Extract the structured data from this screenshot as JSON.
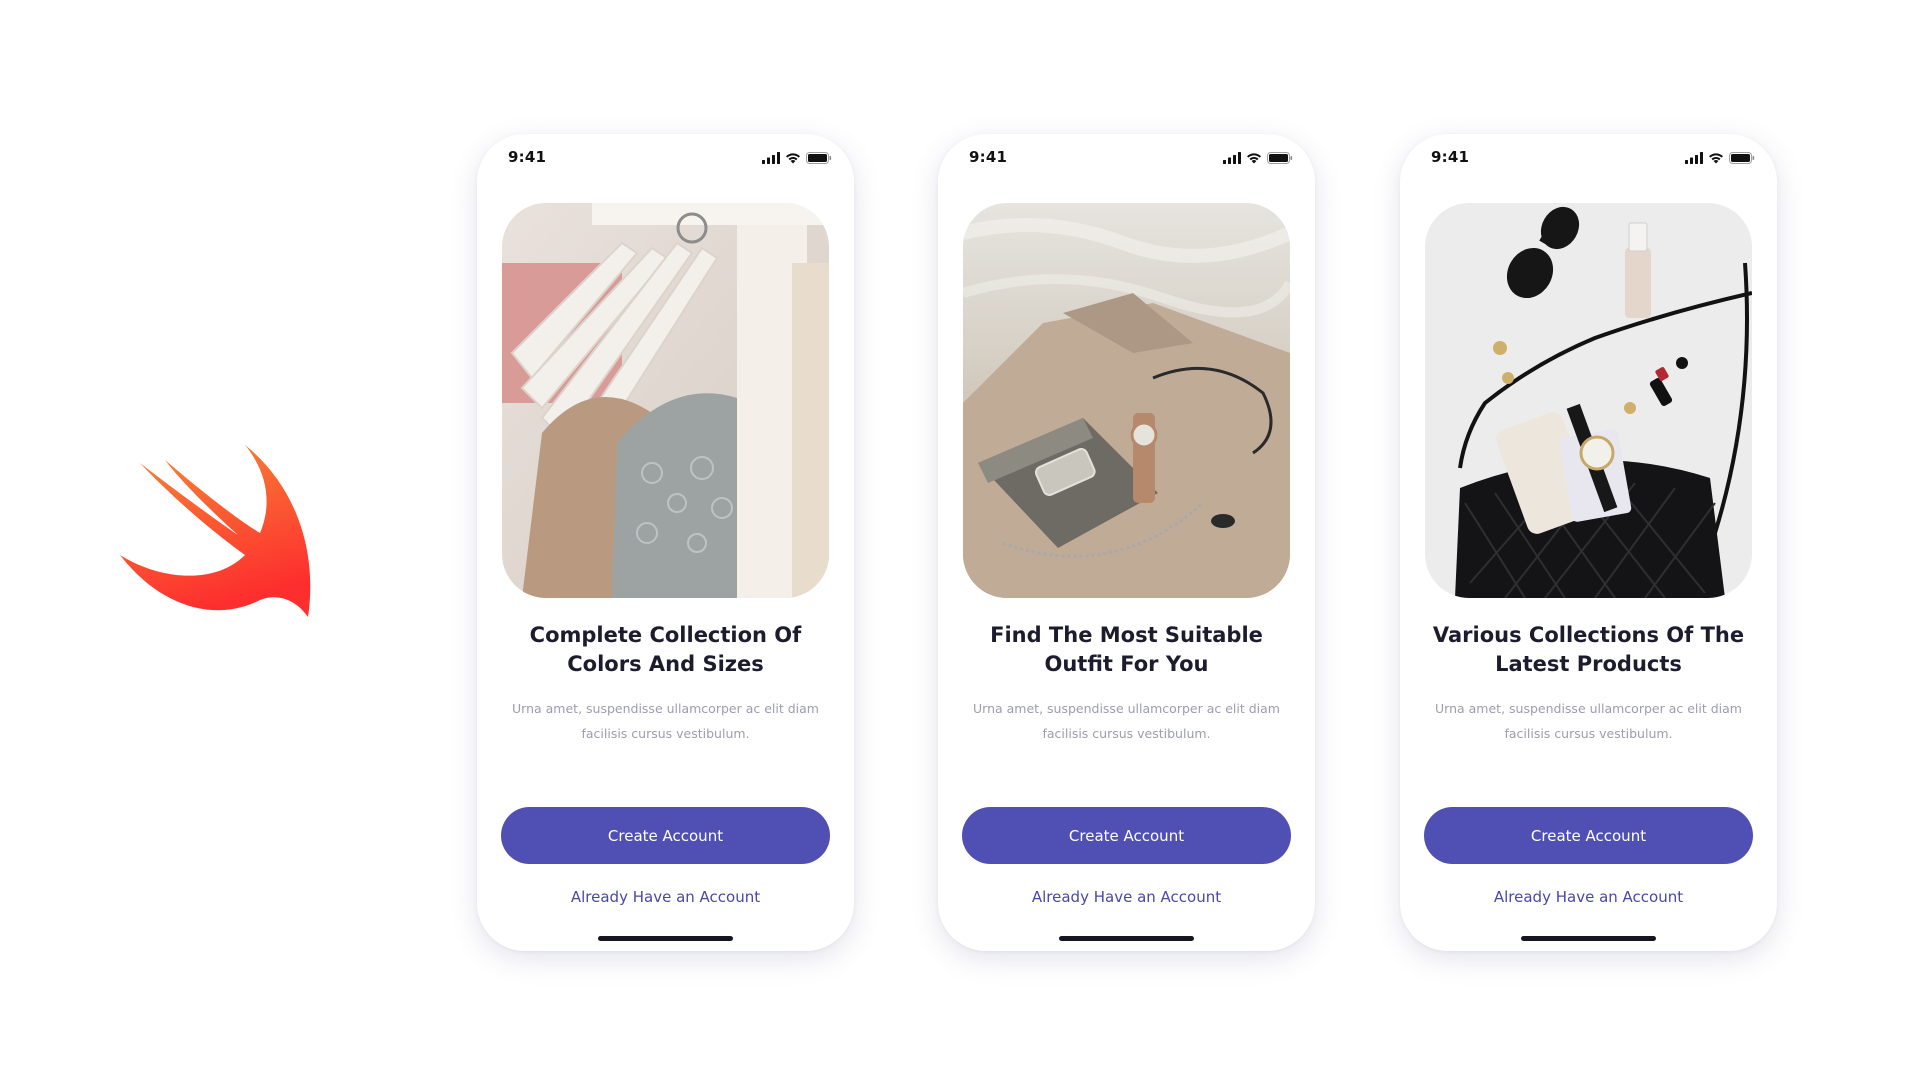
{
  "brand": {
    "logo_icon": "swift-bird-logo",
    "logo_gradient": [
      "#f88a36",
      "#fd2e2e"
    ]
  },
  "theme": {
    "primary": "#5050b4",
    "title_color": "#1c1c2e",
    "desc_color": "#9d9daf"
  },
  "screens": [
    {
      "status_time": "9:41",
      "status_icons": [
        "cellular-signal-icon",
        "wifi-icon",
        "battery-icon"
      ],
      "hero_image": "clothes-on-hangers-photo",
      "title_line1": "Complete Collection Of",
      "title_line2": "Colors And Sizes",
      "desc_line1": "Urna amet, suspendisse ullamcorper ac elit diam",
      "desc_line2": "facilisis cursus vestibulum.",
      "primary_label": "Create Account",
      "secondary_label": "Already Have an Account"
    },
    {
      "status_time": "9:41",
      "status_icons": [
        "cellular-signal-icon",
        "wifi-icon",
        "battery-icon"
      ],
      "hero_image": "bag-and-watch-on-beige-coat-photo",
      "title_line1": "Find The Most Suitable",
      "title_line2": "Outfit For You",
      "desc_line1": "Urna amet, suspendisse ullamcorper ac elit diam",
      "desc_line2": "facilisis cursus vestibulum.",
      "primary_label": "Create Account",
      "secondary_label": "Already Have an Account"
    },
    {
      "status_time": "9:41",
      "status_icons": [
        "cellular-signal-icon",
        "wifi-icon",
        "battery-icon"
      ],
      "hero_image": "handbag-flatlay-with-sunglasses-photo",
      "title_line1": "Various Collections Of The",
      "title_line2": "Latest Products",
      "desc_line1": "Urna amet, suspendisse ullamcorper ac elit diam",
      "desc_line2": "facilisis cursus vestibulum.",
      "primary_label": "Create Account",
      "secondary_label": "Already Have an Account"
    }
  ]
}
